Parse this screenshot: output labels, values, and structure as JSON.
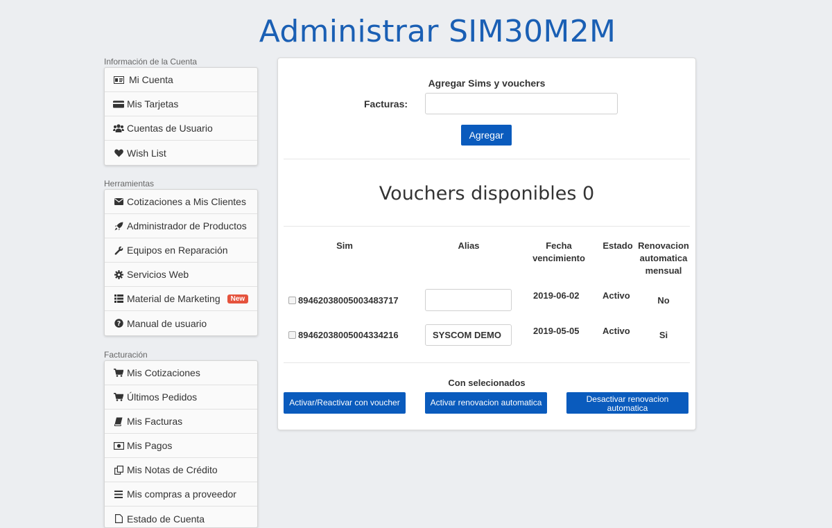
{
  "page": {
    "title": "Administrar SIM30M2M"
  },
  "sidebar": {
    "sections": [
      {
        "label": "Información de la Cuenta",
        "items": [
          {
            "label": "Mi Cuenta",
            "icon": "id-card-icon"
          },
          {
            "label": "Mis Tarjetas",
            "icon": "credit-card-icon"
          },
          {
            "label": "Cuentas de Usuario",
            "icon": "users-icon"
          },
          {
            "label": "Wish List",
            "icon": "heart-icon"
          }
        ]
      },
      {
        "label": "Herramientas",
        "items": [
          {
            "label": "Cotizaciones a Mis Clientes",
            "icon": "envelope-icon"
          },
          {
            "label": "Administrador de Productos",
            "icon": "rocket-icon"
          },
          {
            "label": "Equipos en Reparación",
            "icon": "wrench-icon"
          },
          {
            "label": "Servicios Web",
            "icon": "gear-icon"
          },
          {
            "label": "Material de Marketing",
            "icon": "list-icon",
            "badge": "New"
          },
          {
            "label": "Manual de usuario",
            "icon": "question-circle-icon"
          }
        ]
      },
      {
        "label": "Facturación",
        "items": [
          {
            "label": "Mis Cotizaciones",
            "icon": "cart-icon"
          },
          {
            "label": "Últimos Pedidos",
            "icon": "cart-icon"
          },
          {
            "label": "Mis Facturas",
            "icon": "book-icon"
          },
          {
            "label": "Mis Pagos",
            "icon": "money-icon"
          },
          {
            "label": "Mis Notas de Crédito",
            "icon": "copy-icon"
          },
          {
            "label": "Mis compras a proveedor",
            "icon": "bars-icon"
          },
          {
            "label": "Estado de Cuenta",
            "icon": "document-icon"
          }
        ]
      }
    ]
  },
  "add_section": {
    "title": "Agregar Sims y vouchers",
    "facturas_label": "Facturas:",
    "facturas_value": "",
    "add_button": "Agregar"
  },
  "vouchers": {
    "heading": "Vouchers disponibles 0"
  },
  "table": {
    "headers": {
      "sim": "Sim",
      "alias": "Alias",
      "fecha": "Fecha vencimiento",
      "estado": "Estado",
      "renovacion": "Renovacion automatica mensual"
    },
    "rows": [
      {
        "sim": "89462038005003483717",
        "alias": "",
        "fecha": "2019-06-02",
        "estado": "Activo",
        "renovacion": "No"
      },
      {
        "sim": "89462038005004334216",
        "alias": "SYSCOM DEMO",
        "fecha": "2019-05-05",
        "estado": "Activo",
        "renovacion": "Si"
      }
    ]
  },
  "bulk": {
    "label": "Con selecionados",
    "activate_voucher": "Activar/Reactivar con voucher",
    "activate_renewal": "Activar renovacion automatica",
    "deactivate_renewal": "Desactivar renovacion automatica"
  },
  "colors": {
    "brand": "#1a5fb4",
    "button": "#0a5bbd",
    "badge": "#e5533d"
  }
}
